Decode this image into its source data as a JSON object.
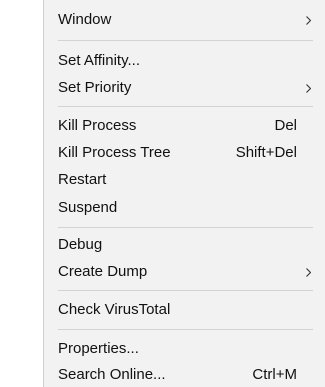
{
  "menu": {
    "items": [
      {
        "label": "Window",
        "shortcut": "",
        "submenu": true
      },
      {
        "label": "Set Affinity...",
        "shortcut": "",
        "submenu": false
      },
      {
        "label": "Set Priority",
        "shortcut": "",
        "submenu": true
      },
      {
        "label": "Kill Process",
        "shortcut": "Del",
        "submenu": false
      },
      {
        "label": "Kill Process Tree",
        "shortcut": "Shift+Del",
        "submenu": false
      },
      {
        "label": "Restart",
        "shortcut": "",
        "submenu": false
      },
      {
        "label": "Suspend",
        "shortcut": "",
        "submenu": false
      },
      {
        "label": "Debug",
        "shortcut": "",
        "submenu": false
      },
      {
        "label": "Create Dump",
        "shortcut": "",
        "submenu": true
      },
      {
        "label": "Check VirusTotal",
        "shortcut": "",
        "submenu": false
      },
      {
        "label": "Properties...",
        "shortcut": "",
        "submenu": false
      },
      {
        "label": "Search Online...",
        "shortcut": "Ctrl+M",
        "submenu": false
      }
    ]
  },
  "colors": {
    "menu_background": "#f2f2f2",
    "separator": "#d3d3d3",
    "text": "#111111"
  }
}
